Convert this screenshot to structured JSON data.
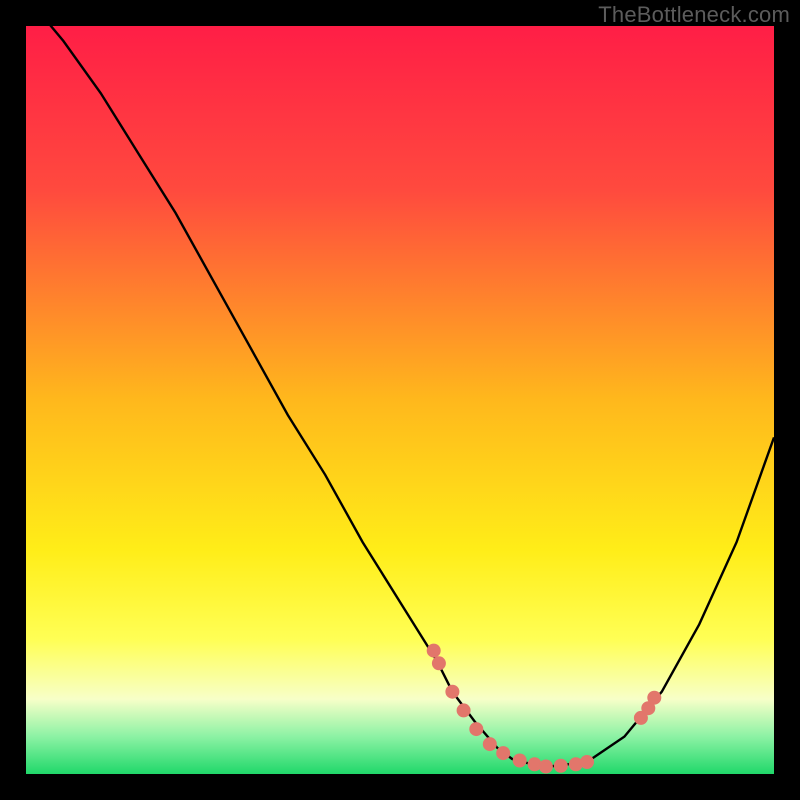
{
  "attribution": "TheBottleneck.com",
  "colors": {
    "red": "#ff1e46",
    "orange": "#ffb400",
    "yellow": "#ffff1a",
    "pale_yellow": "#ffff9a",
    "green": "#20d86a",
    "black": "#000000",
    "curve": "#000000",
    "points": "#e2766b"
  },
  "chart_data": {
    "type": "line",
    "title": "",
    "xlabel": "",
    "ylabel": "",
    "xlim": [
      0,
      100
    ],
    "ylim": [
      0,
      100
    ],
    "curve": {
      "name": "bottleneck-curve",
      "x": [
        0,
        5,
        10,
        15,
        20,
        25,
        30,
        35,
        40,
        45,
        50,
        55,
        57,
        60,
        63,
        65,
        68,
        70,
        75,
        80,
        85,
        90,
        95,
        100
      ],
      "y": [
        104,
        98,
        91,
        83,
        75,
        66,
        57,
        48,
        40,
        31,
        23,
        15,
        11,
        7,
        3.5,
        2,
        1.2,
        1,
        1.6,
        5,
        11,
        20,
        31,
        45
      ]
    },
    "series": [
      {
        "name": "sample-points",
        "x": [
          54.5,
          55.2,
          57.0,
          58.5,
          60.2,
          62.0,
          63.8,
          66.0,
          68.0,
          69.5,
          71.5,
          73.5,
          75.0,
          82.2,
          83.2,
          84.0
        ],
        "y": [
          16.5,
          14.8,
          11.0,
          8.5,
          6.0,
          4.0,
          2.8,
          1.8,
          1.3,
          1.0,
          1.1,
          1.3,
          1.6,
          7.5,
          8.8,
          10.2
        ]
      }
    ],
    "background_gradient": {
      "stops": [
        {
          "pos": 0.0,
          "color": "#ff1e46"
        },
        {
          "pos": 0.22,
          "color": "#ff4a3e"
        },
        {
          "pos": 0.5,
          "color": "#ffb81c"
        },
        {
          "pos": 0.7,
          "color": "#ffed18"
        },
        {
          "pos": 0.82,
          "color": "#ffff55"
        },
        {
          "pos": 0.9,
          "color": "#f7ffc8"
        },
        {
          "pos": 0.95,
          "color": "#8cf2a4"
        },
        {
          "pos": 1.0,
          "color": "#20d86a"
        }
      ]
    }
  }
}
